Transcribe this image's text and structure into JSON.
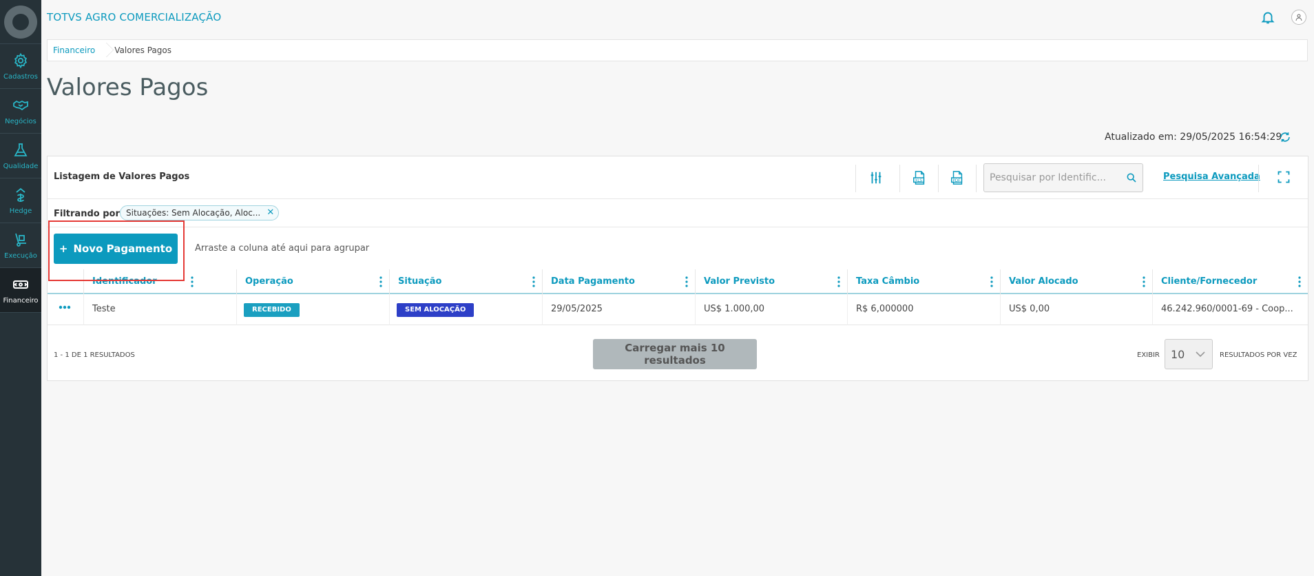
{
  "app": {
    "title": "TOTVS AGRO COMERCIALIZAÇÃO"
  },
  "sidebar": {
    "items": [
      {
        "label": "Cadastros",
        "icon": "gear-icon"
      },
      {
        "label": "Negócios",
        "icon": "handshake-icon"
      },
      {
        "label": "Qualidade",
        "icon": "flask-icon"
      },
      {
        "label": "Hedge",
        "icon": "hedge-icon"
      },
      {
        "label": "Execução",
        "icon": "hand-truck-icon"
      },
      {
        "label": "Financeiro",
        "icon": "money-icon"
      }
    ],
    "active": "Financeiro"
  },
  "breadcrumb": {
    "parent": "Financeiro",
    "current": "Valores Pagos"
  },
  "page": {
    "title": "Valores Pagos",
    "updated": "Atualizado em: 29/05/2025 16:54:29"
  },
  "list": {
    "title": "Listagem de Valores Pagos",
    "search_placeholder": "Pesquisar por Identific...",
    "advanced_search": "Pesquisa Avançada",
    "filter_label": "Filtrando por:",
    "filter_chip": "Situações: Sem Alocação, Aloc...",
    "filter_remove": "✕",
    "new_button": "Novo Pagamento",
    "new_button_icon": "+",
    "group_hint": "Arraste a coluna até aqui para agrupar"
  },
  "table": {
    "columns": [
      "Identificador",
      "Operação",
      "Situação",
      "Data Pagamento",
      "Valor Previsto",
      "Taxa Câmbio",
      "Valor Alocado",
      "Cliente/Fornecedor"
    ],
    "rows": [
      {
        "identificador": "Teste",
        "operacao": "RECEBIDO",
        "situacao": "SEM ALOCAÇÃO",
        "data_pagamento": "29/05/2025",
        "valor_previsto": "US$ 1.000,00",
        "taxa_cambio": "R$ 6,000000",
        "valor_alocado": "US$ 0,00",
        "cliente_fornecedor": "46.242.960/0001-69 - Coop..."
      }
    ]
  },
  "footer": {
    "results": "1 - 1 DE 1 RESULTADOS",
    "load_more": "Carregar mais 10 resultados",
    "show_label": "EXIBIR",
    "per_page": "10",
    "per_page_label": "RESULTADOS POR VEZ"
  },
  "colors": {
    "primary": "#0c9abe",
    "sidebar": "#263238",
    "badge_recebido": "#1a9fc0",
    "badge_sem_alocacao": "#2d3fc7",
    "highlight": "#e53935"
  }
}
